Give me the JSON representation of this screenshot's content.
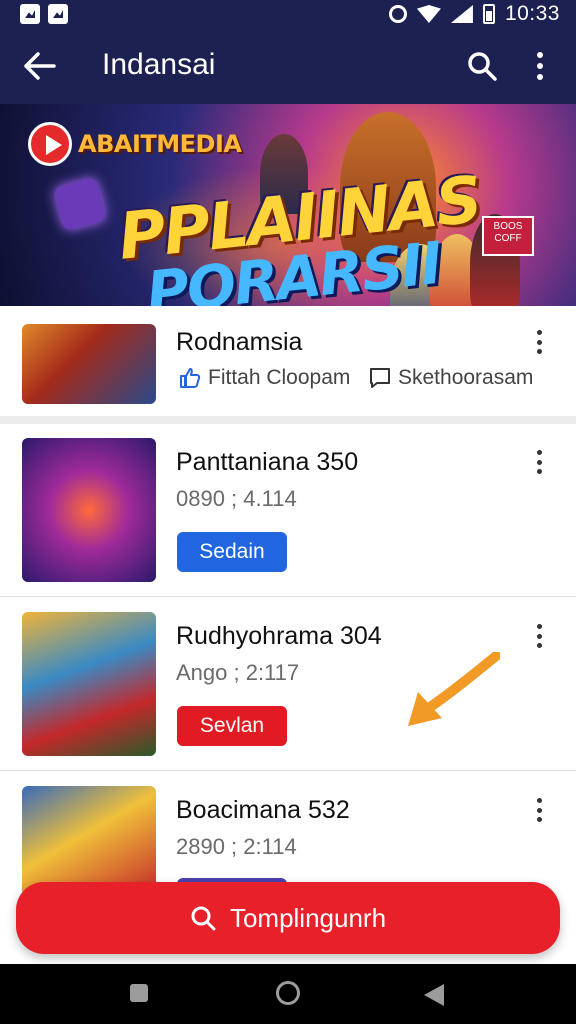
{
  "status_bar": {
    "time": "10:33"
  },
  "app_bar": {
    "title": "Indansai"
  },
  "banner": {
    "brand": "ABAITMEDIA",
    "line1": "PPLAIINAS",
    "line2": "PQRARSII",
    "badge": "BOOS COFF"
  },
  "cards": [
    {
      "title": "Rodnamsia",
      "actions": [
        {
          "icon": "thumb-up-icon",
          "label": "Fittah Cloopam"
        },
        {
          "icon": "comment-icon",
          "label": "Skethoorasam"
        }
      ]
    },
    {
      "title": "Panttaniana 350",
      "meta": "0890 ; 4.114",
      "button": "Sedain",
      "button_color": "#2166e0"
    },
    {
      "title": "Rudhyohrama 304",
      "meta": "Ango ; 2:117",
      "button": "Sevlan",
      "button_color": "#e11a24"
    },
    {
      "title": "Boacimana 532",
      "meta": "2890 ; 2:114",
      "button": "",
      "button_color": "#4a40b0"
    }
  ],
  "bottom_button": {
    "label": "Tomplingunrh",
    "color": "#e8202a"
  },
  "colors": {
    "header": "#1c2151",
    "hint_arrow": "#f29a26"
  }
}
